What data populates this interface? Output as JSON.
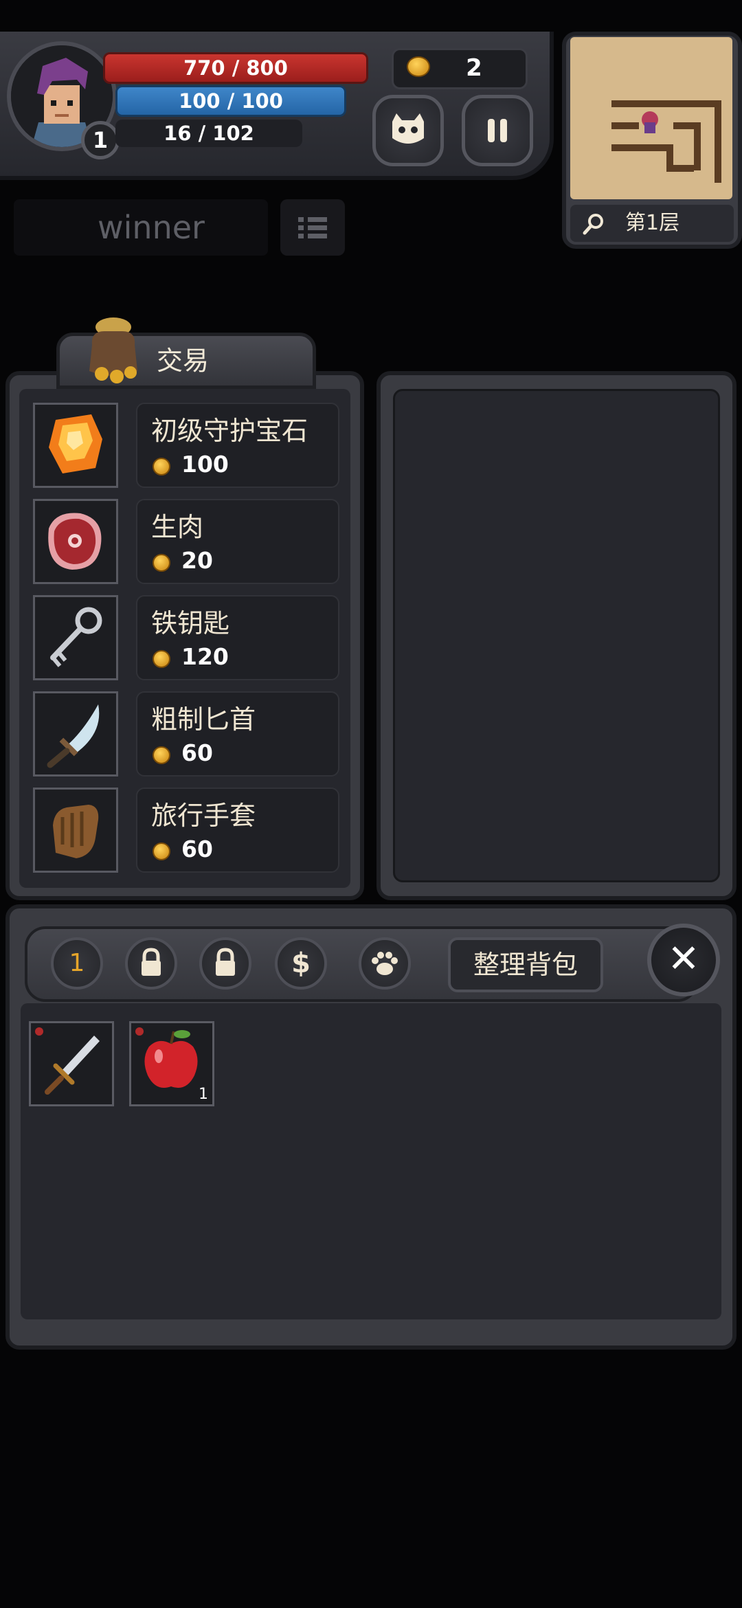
{
  "hud": {
    "hp": "770 / 800",
    "mp": "100 / 100",
    "xp": "16 / 102",
    "level": "1",
    "coins": "2",
    "floor": "第1层"
  },
  "player_name": "winner",
  "trade": {
    "title": "交易",
    "items": [
      {
        "name": "初级守护宝石",
        "price": "100",
        "icon": "amber-gem-icon"
      },
      {
        "name": "生肉",
        "price": "20",
        "icon": "raw-meat-icon"
      },
      {
        "name": "铁钥匙",
        "price": "120",
        "icon": "iron-key-icon"
      },
      {
        "name": "粗制匕首",
        "price": "60",
        "icon": "dagger-icon"
      },
      {
        "name": "旅行手套",
        "price": "60",
        "icon": "glove-icon"
      }
    ]
  },
  "backpack": {
    "tabs": [
      "1",
      "lock-icon",
      "lock-icon",
      "$",
      "paw-icon"
    ],
    "sort_label": "整理背包",
    "close_label": "✕",
    "slots": [
      {
        "icon": "sword-icon",
        "qty": ""
      },
      {
        "icon": "apple-icon",
        "qty": "1"
      }
    ]
  }
}
